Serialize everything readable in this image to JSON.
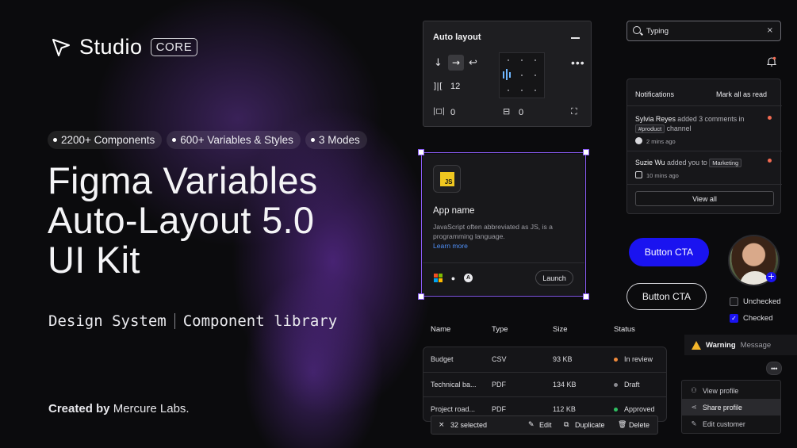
{
  "brand": {
    "name": "Studio",
    "badge": "CORE"
  },
  "pills": [
    "2200+ Components",
    "600+ Variables & Styles",
    "3 Modes"
  ],
  "headline": [
    "Figma Variables",
    "Auto-Layout 5.0",
    "UI Kit"
  ],
  "subtitle": {
    "left": "Design System",
    "right": "Component library"
  },
  "credit": {
    "prefix": "Created by",
    "name": "Mercure Labs."
  },
  "auto_layout": {
    "title": "Auto layout",
    "gap": "12",
    "padding_h": "0",
    "padding_v": "0",
    "icons": [
      "arrow-down-icon",
      "arrow-right-icon",
      "wrap-icon",
      "spacing-icon",
      "padding-horizontal-icon",
      "padding-vertical-icon",
      "resize-icon"
    ]
  },
  "app_card": {
    "name": "App name",
    "description": "JavaScript often abbreviated as JS, is a programming language.",
    "link": "Learn more",
    "launch": "Launch",
    "logo": "JS"
  },
  "table": {
    "headers": [
      "Name",
      "Type",
      "Size",
      "Status"
    ],
    "rows": [
      {
        "name": "Budget",
        "type": "CSV",
        "size": "93 KB",
        "status": "In review",
        "status_color": "#f08a3c"
      },
      {
        "name": "Technical ba...",
        "type": "PDF",
        "size": "134 KB",
        "status": "Draft",
        "status_color": "#8a8a90"
      },
      {
        "name": "Project road...",
        "type": "PDF",
        "size": "112 KB",
        "status": "Approved",
        "status_color": "#2fbf62"
      }
    ],
    "bulk": {
      "close": "×",
      "selected": "32 selected",
      "edit": "Edit",
      "duplicate": "Duplicate",
      "delete": "Delete"
    }
  },
  "search": {
    "value": "Typing",
    "clear": "×"
  },
  "notifications": {
    "title": "Notifications",
    "mark_all": "Mark all as read",
    "items": [
      {
        "user": "Sylvia Reyes",
        "action": " added 3 comments in ",
        "tag": "#product",
        "suffix": " channel",
        "time": "2 mins ago"
      },
      {
        "user": "Suzie Wu",
        "action": " added you to ",
        "tag": "Marketing",
        "suffix": "",
        "time": "10 mins ago"
      }
    ],
    "view_all": "View all"
  },
  "buttons": {
    "primary": "Button CTA",
    "outline": "Button CTA"
  },
  "checkboxes": [
    {
      "label": "Unchecked",
      "checked": false
    },
    {
      "label": "Checked",
      "checked": true
    }
  ],
  "warning": {
    "title": "Warning",
    "message": "Message"
  },
  "menu": {
    "more": "•••",
    "items": [
      {
        "label": "View profile",
        "icon": "user-icon"
      },
      {
        "label": "Share profile",
        "icon": "share-icon"
      },
      {
        "label": "Edit customer",
        "icon": "pencil-icon"
      }
    ]
  },
  "colors": {
    "accent": "#1a13f0",
    "selection": "#8a5cf5",
    "warning": "#f3b52a",
    "link": "#4f8ff7"
  }
}
